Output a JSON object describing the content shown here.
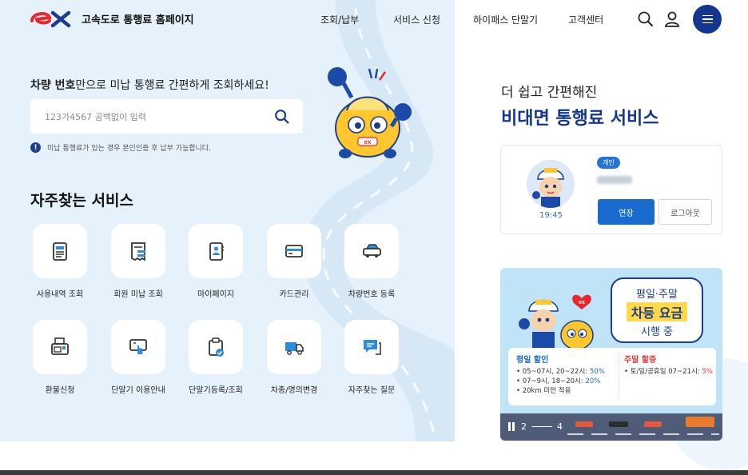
{
  "header": {
    "logo_text": "고속도로 통행료 홈페이지",
    "nav": [
      {
        "label": "조회/납부"
      },
      {
        "label": "서비스 신청"
      },
      {
        "label": "하이패스 단말기"
      },
      {
        "label": "고객센터"
      }
    ]
  },
  "search": {
    "heading_bold": "차량 번호",
    "heading_rest": "만으로 미납 통행료 간편하게 조회하세요!",
    "placeholder": "123가4567 공백없이 입력",
    "notice_icon": "!",
    "notice": "미납 통행료가 있는 경우 본인인증 후 납부 가능합니다."
  },
  "services": {
    "title": "자주찾는 서비스",
    "items": [
      {
        "label": "사용내역 조회",
        "icon": "document-list-icon"
      },
      {
        "label": "회원 미납 조회",
        "icon": "receipt-icon"
      },
      {
        "label": "마이페이지",
        "icon": "profile-book-icon"
      },
      {
        "label": "카드관리",
        "icon": "credit-card-icon"
      },
      {
        "label": "차량번호 등록",
        "icon": "car-icon"
      },
      {
        "label": "환불신청",
        "icon": "printer-icon"
      },
      {
        "label": "단말기 이용안내",
        "icon": "touch-screen-icon"
      },
      {
        "label": "단말기등록/조회",
        "icon": "clipboard-check-icon"
      },
      {
        "label": "차종/명의변경",
        "icon": "truck-icon"
      },
      {
        "label": "자주찾는 질문",
        "icon": "chat-icon"
      }
    ]
  },
  "right": {
    "subtitle": "더 쉽고 간편해진",
    "title": "비대면 통행료 서비스"
  },
  "account": {
    "badge": "개인",
    "timer": "19:45",
    "extend_label": "연장",
    "logout_label": "로그아웃"
  },
  "banner": {
    "sign_line1": "평일·주말",
    "sign_line2": "차등 요금",
    "sign_line3": "시행 중",
    "weekday": {
      "title": "평일 할인",
      "lines": [
        {
          "text": "• 05~07시, 20~22시: ",
          "hl": "50%"
        },
        {
          "text": "• 07~9시, 18~20시: ",
          "hl": "20%"
        },
        {
          "text": "• 20km 미만 적용",
          "hl": ""
        }
      ]
    },
    "weekend": {
      "title": "주말 할증",
      "lines": [
        {
          "text": "• 토/일/공휴일 07~21시: ",
          "hl": "5%"
        }
      ]
    },
    "pager_current": "2",
    "pager_total": "4"
  },
  "colors": {
    "brand_navy": "#13378f",
    "brand_red": "#e8262d",
    "accent_blue": "#1a6bd0",
    "hero_bg": "#e6f2fb",
    "highlight_red": "#e03a3a"
  }
}
